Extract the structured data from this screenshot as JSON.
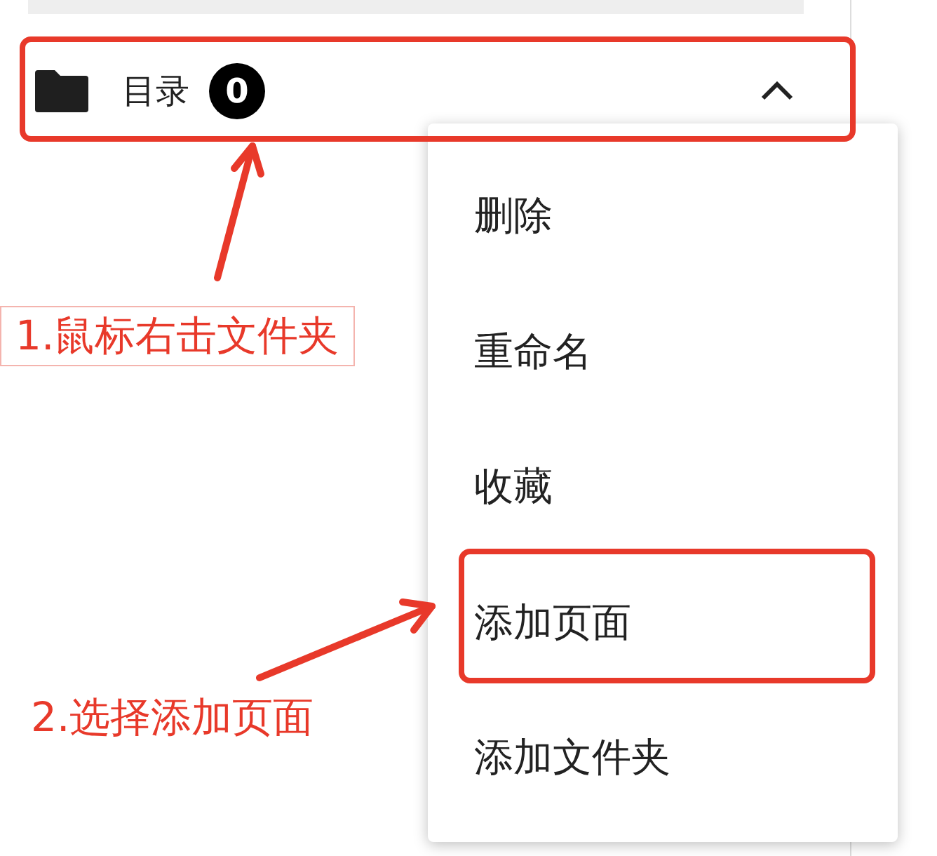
{
  "folder_row": {
    "label": "目录",
    "count": "0",
    "expanded": true
  },
  "context_menu": {
    "items": [
      {
        "label": "删除",
        "highlighted": false
      },
      {
        "label": "重命名",
        "highlighted": false
      },
      {
        "label": "收藏",
        "highlighted": false
      },
      {
        "label": "添加页面",
        "highlighted": true
      },
      {
        "label": "添加文件夹",
        "highlighted": false
      }
    ]
  },
  "annotations": [
    {
      "text": "1.鼠标右击文件夹",
      "framed": true
    },
    {
      "text": "2.选择添加页面",
      "framed": false
    }
  ]
}
